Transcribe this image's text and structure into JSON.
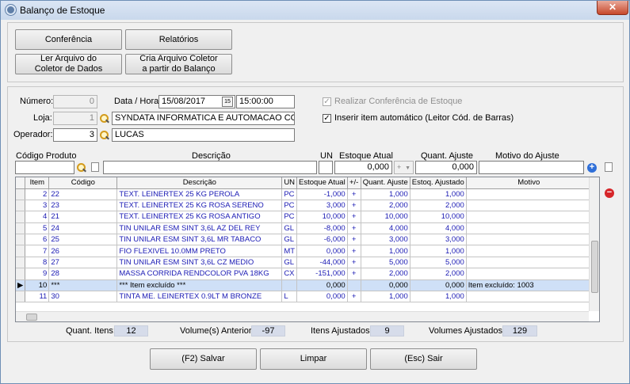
{
  "window": {
    "title": "Balanço de Estoque",
    "close_glyph": "✕"
  },
  "top_buttons": {
    "conferencia": "Conferência",
    "relatorios": "Relatórios",
    "ler_arquivo_1": "Ler Arquivo do",
    "ler_arquivo_2": "Coletor de Dados",
    "cria_arquivo_1": "Cria Arquivo Coletor",
    "cria_arquivo_2": "a partir do Balanço"
  },
  "form": {
    "numero_label": "Número:",
    "numero_value": "0",
    "data_hora_label": "Data / Hora:",
    "date_value": "15/08/2017",
    "date_btn": "15",
    "time_value": "15:00:00",
    "loja_label": "Loja:",
    "loja_code": "1",
    "loja_name": "SYNDATA INFORMATICA E AUTOMACAO COME",
    "operador_label": "Operador:",
    "operador_code": "3",
    "operador_name": "LUCAS",
    "realizar_label": "Realizar Conferência de Estoque",
    "inserir_label": "Inserir item automático (Leitor Cód. de Barras)",
    "check_glyph": "✓"
  },
  "entry": {
    "codigo_label": "Código Produto",
    "descricao_label": "Descrição",
    "un_label": "UN",
    "estoque_label": "Estoque Atual",
    "quant_label": "Quant. Ajuste",
    "motivo_label": "Motivo do Ajuste",
    "estoque_value": "0,000",
    "sign_value": "+",
    "quant_value": "0,000",
    "add_glyph": "+",
    "remove_glyph": "−"
  },
  "grid": {
    "headers": [
      "Item",
      "Código",
      "Descrição",
      "UN",
      "Estoque Atual",
      "+/-",
      "Quant. Ajuste",
      "Estoq. Ajustado",
      "Motivo"
    ],
    "rows": [
      {
        "ind": "",
        "item": "2",
        "codigo": "22",
        "descricao": "TEXT. LEINERTEX 25 KG PEROLA",
        "un": "PC",
        "estoque": "-1,000",
        "sinal": "+",
        "quant": "1,000",
        "ajustado": "1,000",
        "motivo": ""
      },
      {
        "ind": "",
        "item": "3",
        "codigo": "23",
        "descricao": "TEXT. LEINERTEX 25 KG ROSA SERENO",
        "un": "PC",
        "estoque": "3,000",
        "sinal": "+",
        "quant": "2,000",
        "ajustado": "2,000",
        "motivo": ""
      },
      {
        "ind": "",
        "item": "4",
        "codigo": "21",
        "descricao": "TEXT. LEINERTEX 25 KG ROSA ANTIGO",
        "un": "PC",
        "estoque": "10,000",
        "sinal": "+",
        "quant": "10,000",
        "ajustado": "10,000",
        "motivo": ""
      },
      {
        "ind": "",
        "item": "5",
        "codigo": "24",
        "descricao": "TIN UNILAR ESM SINT 3,6L AZ DEL REY",
        "un": "GL",
        "estoque": "-8,000",
        "sinal": "+",
        "quant": "4,000",
        "ajustado": "4,000",
        "motivo": ""
      },
      {
        "ind": "",
        "item": "6",
        "codigo": "25",
        "descricao": "TIN UNILAR ESM SINT 3,6L MR TABACO",
        "un": "GL",
        "estoque": "-6,000",
        "sinal": "+",
        "quant": "3,000",
        "ajustado": "3,000",
        "motivo": ""
      },
      {
        "ind": "",
        "item": "7",
        "codigo": "26",
        "descricao": "FIO FLEXIVEL 10.0MM PRETO",
        "un": "MT",
        "estoque": "0,000",
        "sinal": "+",
        "quant": "1,000",
        "ajustado": "1,000",
        "motivo": ""
      },
      {
        "ind": "",
        "item": "8",
        "codigo": "27",
        "descricao": "TIN UNILAR ESM SINT 3,6L CZ MEDIO",
        "un": "GL",
        "estoque": "-44,000",
        "sinal": "+",
        "quant": "5,000",
        "ajustado": "5,000",
        "motivo": ""
      },
      {
        "ind": "",
        "item": "9",
        "codigo": "28",
        "descricao": "MASSA CORRIDA RENDCOLOR PVA 18KG",
        "un": "CX",
        "estoque": "-151,000",
        "sinal": "+",
        "quant": "2,000",
        "ajustado": "2,000",
        "motivo": ""
      },
      {
        "ind": "▶",
        "item": "10",
        "codigo": "***",
        "descricao": "*** Item excluído ***",
        "un": "",
        "estoque": "0,000",
        "sinal": "",
        "quant": "0,000",
        "ajustado": "0,000",
        "motivo": "Item excluído: 1003"
      },
      {
        "ind": "",
        "item": "11",
        "codigo": "30",
        "descricao": "TINTA ME. LEINERTEX 0.9LT M BRONZE",
        "un": "L",
        "estoque": "0,000",
        "sinal": "+",
        "quant": "1,000",
        "ajustado": "1,000",
        "motivo": ""
      }
    ]
  },
  "summary": {
    "quant_itens_label": "Quant. Itens:",
    "quant_itens_value": "12",
    "volumes_anterior_label": "Volume(s) Anterior:",
    "volumes_anterior_value": "-97",
    "itens_ajustados_label": "Itens Ajustados:",
    "itens_ajustados_value": "9",
    "volumes_ajustados_label": "Volumes Ajustados:",
    "volumes_ajustados_value": "129"
  },
  "bottom_buttons": {
    "salvar": "(F2) Salvar",
    "limpar": "Limpar",
    "sair": "(Esc) Sair"
  },
  "colors": {
    "row_text": "#1a1ab4",
    "selected_row": "#cfe0f7",
    "summary_box": "#d6dcea",
    "add_icon": "#2f6fd8",
    "remove_icon": "#d6262a"
  }
}
